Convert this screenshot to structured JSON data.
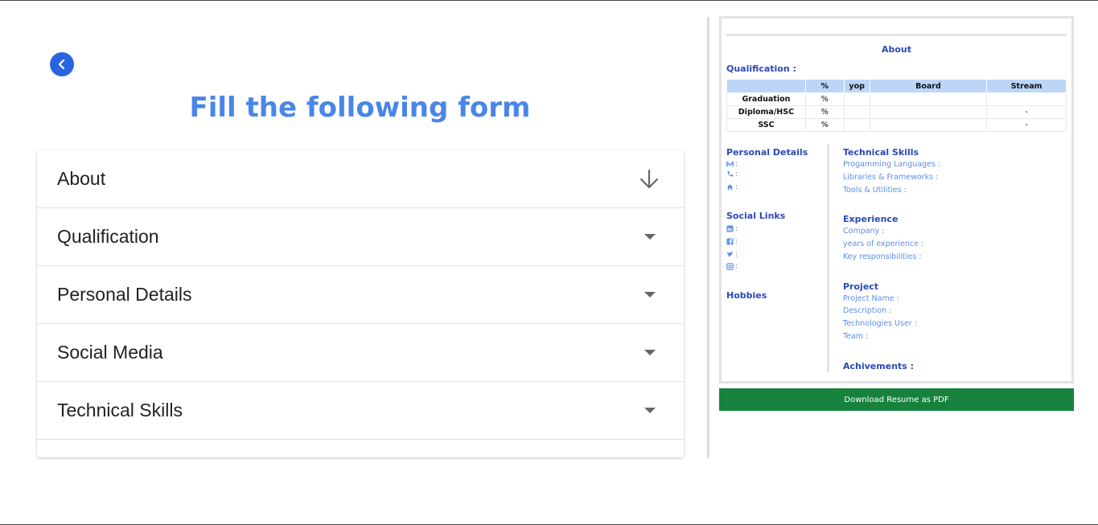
{
  "form": {
    "title": "Fill the following form",
    "sections": [
      "About",
      "Qualification",
      "Personal Details",
      "Social Media",
      "Technical Skills"
    ]
  },
  "resume": {
    "about_heading": "About",
    "qualification_heading": "Qualification :",
    "table": {
      "headers": [
        "",
        "%",
        "yop",
        "Board",
        "Stream"
      ],
      "rows": [
        [
          "Graduation",
          "%",
          "",
          "",
          ""
        ],
        [
          "Diploma/HSC",
          "%",
          "",
          "",
          "-"
        ],
        [
          "SSC",
          "%",
          "",
          "",
          "-"
        ]
      ]
    },
    "personal_details_heading": "Personal Details",
    "social_links_heading": "Social Links",
    "hobbies_heading": "Hobbies",
    "contact_sep": ":",
    "technical_skills": {
      "heading": "Technical Skills",
      "lines": [
        "Progamming Languages :",
        "Libraries & Frameworks :",
        "Tools & Utilities :"
      ]
    },
    "experience": {
      "heading": "Experience",
      "lines": [
        "Company :",
        "years of experience :",
        "Key responsibilities :"
      ]
    },
    "project": {
      "heading": "Project",
      "lines": [
        "Project Name :",
        "Description :",
        "Technologies User :",
        "Team :"
      ]
    },
    "achievements_heading": "Achivements :"
  },
  "download_button": "Download Resume as PDF",
  "colors": {
    "accent": "#2864e0",
    "title": "#4a86e8",
    "resume_heading": "#2a48b8",
    "resume_text": "#5b8fe8",
    "download": "#17823e",
    "table_header": "#bcd6f8"
  },
  "icons": [
    "chevron-left-icon",
    "arrow-down-icon",
    "caret-down-icon",
    "mail-icon",
    "phone-icon",
    "home-icon",
    "linkedin-icon",
    "facebook-icon",
    "twitter-icon",
    "instagram-icon"
  ]
}
